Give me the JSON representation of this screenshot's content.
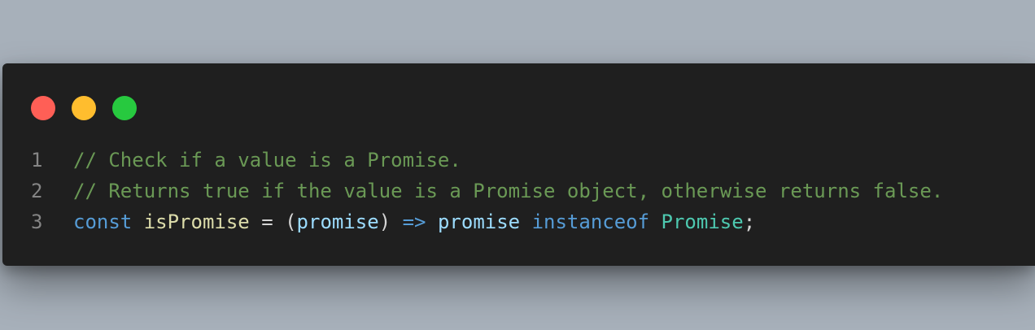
{
  "window": {
    "traffic_lights": [
      {
        "name": "close",
        "color": "#ff5f56"
      },
      {
        "name": "minimize",
        "color": "#ffbd2e"
      },
      {
        "name": "maximize",
        "color": "#27c93f"
      }
    ]
  },
  "code": {
    "lines": [
      {
        "number": "1",
        "tokens": [
          {
            "text": "// Check if a value is a Promise.",
            "type": "comment"
          }
        ]
      },
      {
        "number": "2",
        "tokens": [
          {
            "text": "// Returns true if the value is a Promise object, otherwise returns false.",
            "type": "comment"
          }
        ]
      },
      {
        "number": "3",
        "tokens": [
          {
            "text": "const",
            "type": "keyword"
          },
          {
            "text": " ",
            "type": "punct"
          },
          {
            "text": "isPromise",
            "type": "function"
          },
          {
            "text": " = (",
            "type": "punct"
          },
          {
            "text": "promise",
            "type": "variable"
          },
          {
            "text": ") ",
            "type": "punct"
          },
          {
            "text": "=>",
            "type": "keyword"
          },
          {
            "text": " ",
            "type": "punct"
          },
          {
            "text": "promise",
            "type": "variable"
          },
          {
            "text": " ",
            "type": "punct"
          },
          {
            "text": "instanceof",
            "type": "keyword"
          },
          {
            "text": " ",
            "type": "punct"
          },
          {
            "text": "Promise",
            "type": "class"
          },
          {
            "text": ";",
            "type": "punct"
          }
        ]
      }
    ]
  }
}
